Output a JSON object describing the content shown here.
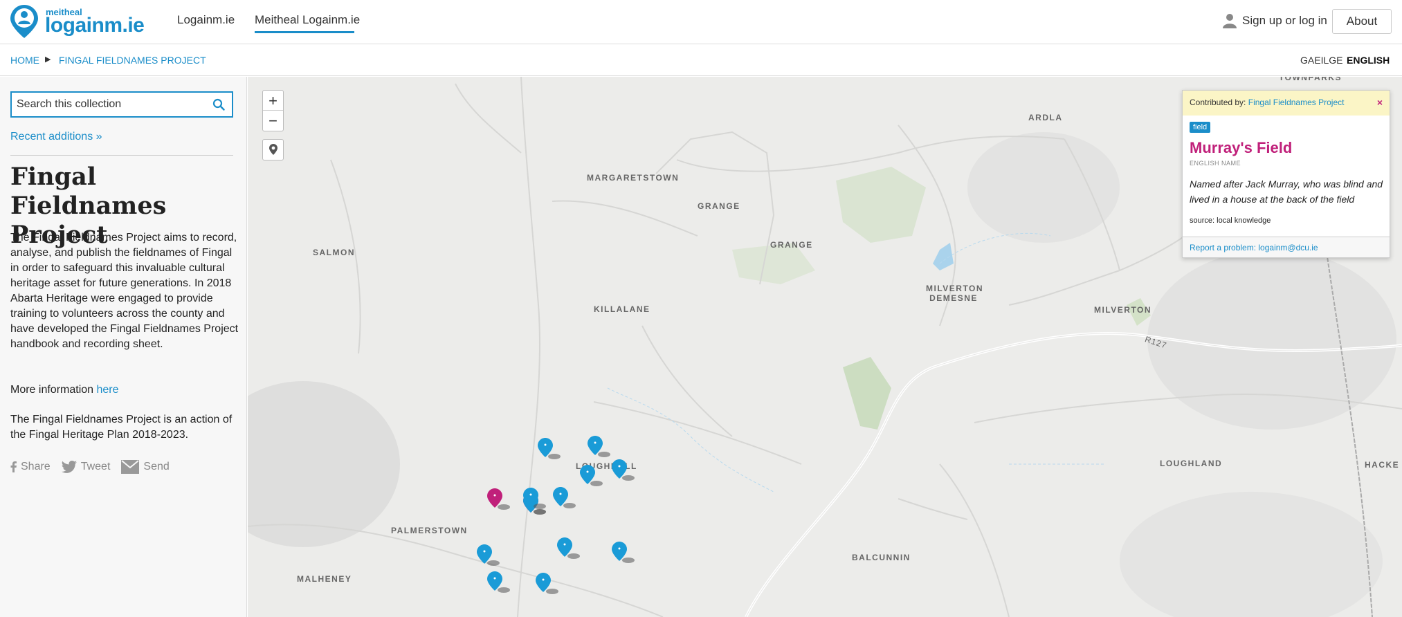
{
  "header": {
    "logo_small": "meitheal",
    "logo_big": "logainm.ie",
    "nav": [
      "Logainm.ie",
      "Meitheal Logainm.ie"
    ],
    "signin_label": "Sign up or log in",
    "about_label": "About"
  },
  "breadcrumb": {
    "home": "HOME",
    "separator": "▶",
    "project": "FINGAL FIELDNAMES PROJECT"
  },
  "languages": {
    "irish": "GAEILGE",
    "english": "ENGLISH"
  },
  "sidebar": {
    "search_placeholder": "Search this collection",
    "recent_link": "Recent additions »",
    "title": "Fingal Fieldnames Project",
    "description": "The Fingal Fieldnames Project aims to record, analyse, and publish the fieldnames of Fingal in order to safeguard this invaluable cultural heritage asset for future generations. In 2018 Abarta Heritage were engaged to provide training to volunteers across the county and have developed the Fingal Fieldnames Project handbook and recording sheet.",
    "more_info_text": "More information",
    "more_info_link": "here",
    "action_text": "The Fingal Fieldnames Project is an action of the Fingal Heritage Plan 2018-2023.",
    "share": [
      "Share",
      "Tweet",
      "Send"
    ]
  },
  "map": {
    "zoom_in": "+",
    "zoom_out": "−",
    "labels": [
      {
        "text": "TOWNPARKS"
      },
      {
        "text": "ARDLA"
      },
      {
        "text": "MARGARETSTOWN"
      },
      {
        "text": "GRANGE"
      },
      {
        "text": "GRANGE"
      },
      {
        "text": "SALMON"
      },
      {
        "text": "KILLALANE"
      },
      {
        "text": "MILVERTON DEMESNE"
      },
      {
        "text": "MILVERTON"
      },
      {
        "text": "R127"
      },
      {
        "text": "LOUGHBALL"
      },
      {
        "text": "LOUGHLAND"
      },
      {
        "text": "HACKE"
      },
      {
        "text": "PALMERSTOWN"
      },
      {
        "text": "BALCUNNIN"
      },
      {
        "text": "MALHENEY"
      }
    ],
    "colors": {
      "marker_blue": "#1a9bd7",
      "marker_selected": "#c0207a",
      "accent": "#1a8dc9"
    }
  },
  "popup": {
    "contributed_prefix": "Contributed by:",
    "contributed_link": "Fingal Fieldnames Project",
    "close": "×",
    "tag": "field",
    "name": "Murray's Field",
    "name_type": "ENGLISH NAME",
    "description": "Named after Jack Murray, who was blind and lived in a house at the back of the field",
    "source": "source: local knowledge",
    "report": "Report a problem: logainm@dcu.ie"
  }
}
